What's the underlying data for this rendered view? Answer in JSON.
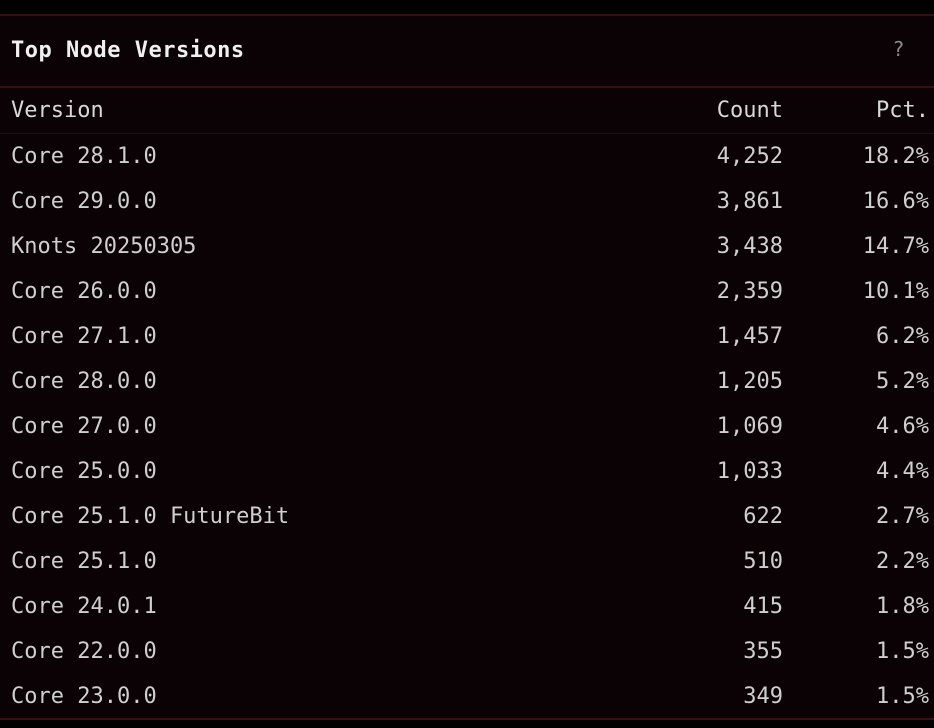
{
  "panel": {
    "title": "Top Node Versions",
    "help_icon": "?"
  },
  "table": {
    "headers": {
      "version": "Version",
      "count": "Count",
      "pct": "Pct."
    },
    "rows": [
      {
        "version": "Core 28.1.0",
        "count": "4,252",
        "pct": "18.2%"
      },
      {
        "version": "Core 29.0.0",
        "count": "3,861",
        "pct": "16.6%"
      },
      {
        "version": "Knots 20250305",
        "count": "3,438",
        "pct": "14.7%"
      },
      {
        "version": "Core 26.0.0",
        "count": "2,359",
        "pct": "10.1%"
      },
      {
        "version": "Core 27.1.0",
        "count": "1,457",
        "pct": "6.2%"
      },
      {
        "version": "Core 28.0.0",
        "count": "1,205",
        "pct": "5.2%"
      },
      {
        "version": "Core 27.0.0",
        "count": "1,069",
        "pct": "4.6%"
      },
      {
        "version": "Core 25.0.0",
        "count": "1,033",
        "pct": "4.4%"
      },
      {
        "version": "Core 25.1.0 FutureBit",
        "count": "622",
        "pct": "2.7%"
      },
      {
        "version": "Core 25.1.0",
        "count": "510",
        "pct": "2.2%"
      },
      {
        "version": "Core 24.0.1",
        "count": "415",
        "pct": "1.8%"
      },
      {
        "version": "Core 22.0.0",
        "count": "355",
        "pct": "1.5%"
      },
      {
        "version": "Core 23.0.0",
        "count": "349",
        "pct": "1.5%"
      }
    ]
  },
  "colors": {
    "background": "#000000",
    "panel_background": "#0a0204",
    "border": "#3a0c14",
    "text": "#cfcfcf",
    "title": "#f0f0f0",
    "muted": "#8a8a8a"
  }
}
